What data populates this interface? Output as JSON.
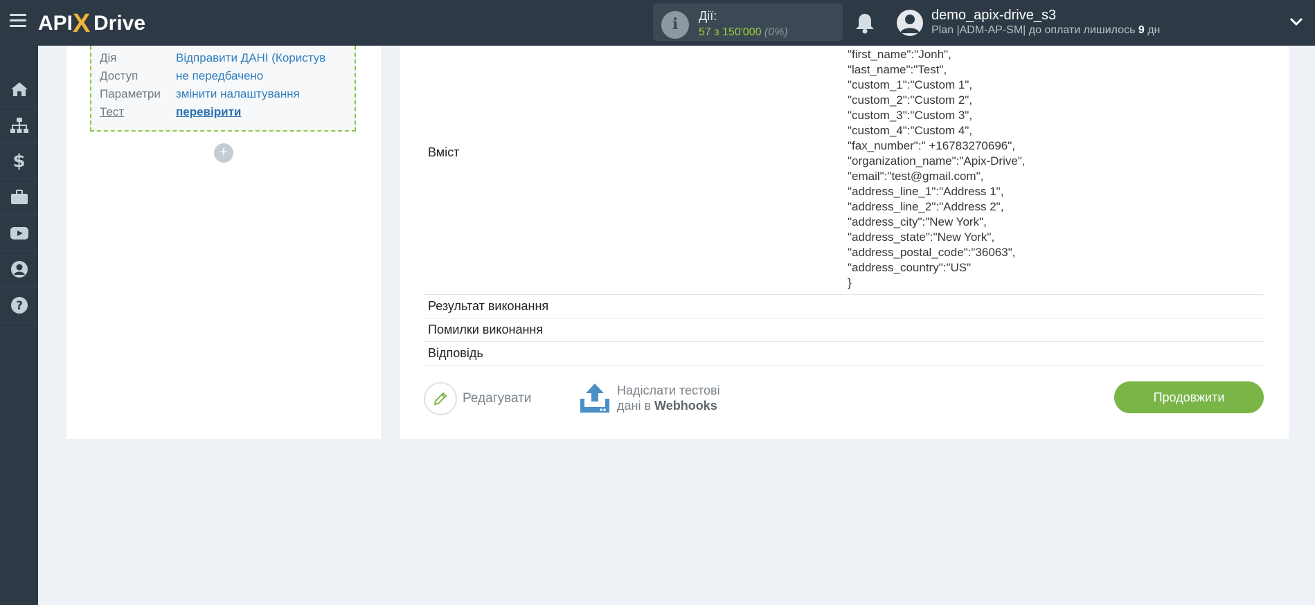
{
  "header": {
    "logo_text": "APIXDrive",
    "actions_title": "Дії:",
    "actions_value": "57 з 150'000",
    "actions_pct": "(0%)",
    "user_name": "demo_apix-drive_s3",
    "plan_prefix": "Plan |ADM-AP-SM| до оплати лишилось ",
    "plan_days": "9",
    "plan_suffix": " дн"
  },
  "sidebar": {
    "items": [
      "home-icon",
      "sitemap-icon",
      "dollar-icon",
      "briefcase-icon",
      "youtube-icon",
      "user-icon",
      "help-icon"
    ]
  },
  "left_card": {
    "rows": [
      {
        "key": "Дія",
        "value": "Відправити ДАНІ (Користув"
      },
      {
        "key": "Доступ",
        "value": "не передбачено"
      },
      {
        "key": "Параметри",
        "value": "змінити налаштування"
      },
      {
        "key": "Тест",
        "value": "перевірити"
      }
    ],
    "plus": "+"
  },
  "right_card": {
    "content_label": "Вміст",
    "json_lines": [
      "\"first_name\":\"Jonh\",",
      "\"last_name\":\"Test\",",
      "\"custom_1\":\"Custom 1\",",
      "\"custom_2\":\"Custom 2\",",
      "\"custom_3\":\"Custom 3\",",
      "\"custom_4\":\"Custom 4\",",
      "\"fax_number\":\" +16783270696\",",
      "\"organization_name\":\"Apix-Drive\",",
      "\"email\":\"test@gmail.com\",",
      "\"address_line_1\":\"Address 1\",",
      "\"address_line_2\":\"Address 2\",",
      "\"address_city\":\"New York\",",
      "\"address_state\":\"New York\",",
      "\"address_postal_code\":\"36063\",",
      "\"address_country\":\"US\"",
      "}"
    ],
    "result_label": "Результат виконання",
    "errors_label": "Помилки виконання",
    "response_label": "Відповідь",
    "edit_label": "Редагувати",
    "send_line1": "Надіслати тестові",
    "send_line2_prefix": "дані в ",
    "send_line2_bold": "Webhooks",
    "continue_label": "Продовжити"
  },
  "colors": {
    "topbar": "#2d3a46",
    "accent_green": "#7ab548",
    "link_blue": "#2f7ebf",
    "dashed_border": "#8cc641"
  }
}
